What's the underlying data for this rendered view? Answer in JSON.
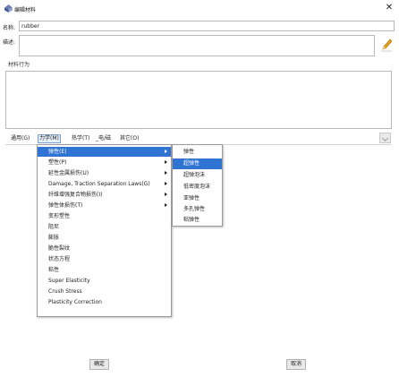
{
  "window": {
    "title": "编辑材料",
    "close_symbol": "✕"
  },
  "fields": {
    "name_label": "名称:",
    "name_value": "rubber",
    "desc_label": "描述:",
    "behaviors_label": "材料行为"
  },
  "menubar": {
    "items": [
      "通用(G)",
      "力学(M)",
      "热学(T)",
      "_电/磁",
      "其它(O)"
    ]
  },
  "mechanical_menu": {
    "items": [
      "弹性(E)",
      "塑性(P)",
      "延性金属损伤(U)",
      "Damage, Traction Separation Laws(G)",
      "纤维增强复合物损伤(I)",
      "弹性体损伤(T)",
      "变形塑性",
      "阻尼",
      "膨胀",
      "脆性裂纹",
      "状态方程",
      "粘性",
      "Super Elasticity",
      "Crush Stress",
      "Plasticity Correction"
    ],
    "submenu_flags": [
      true,
      true,
      true,
      true,
      true,
      true,
      false,
      false,
      false,
      false,
      false,
      false,
      false,
      false,
      false
    ],
    "highlighted_index": 0
  },
  "elastic_submenu": {
    "items": [
      "弹性",
      "超弹性",
      "超弹泡沫",
      "低密度泡沫",
      "亚弹性",
      "多孔弹性",
      "粘弹性"
    ],
    "highlighted_index": 1
  },
  "buttons": {
    "ok_label": "确定",
    "cancel_label": "取消"
  },
  "colors": {
    "highlight": "#2f73d3",
    "pencil": "#e8a317"
  }
}
